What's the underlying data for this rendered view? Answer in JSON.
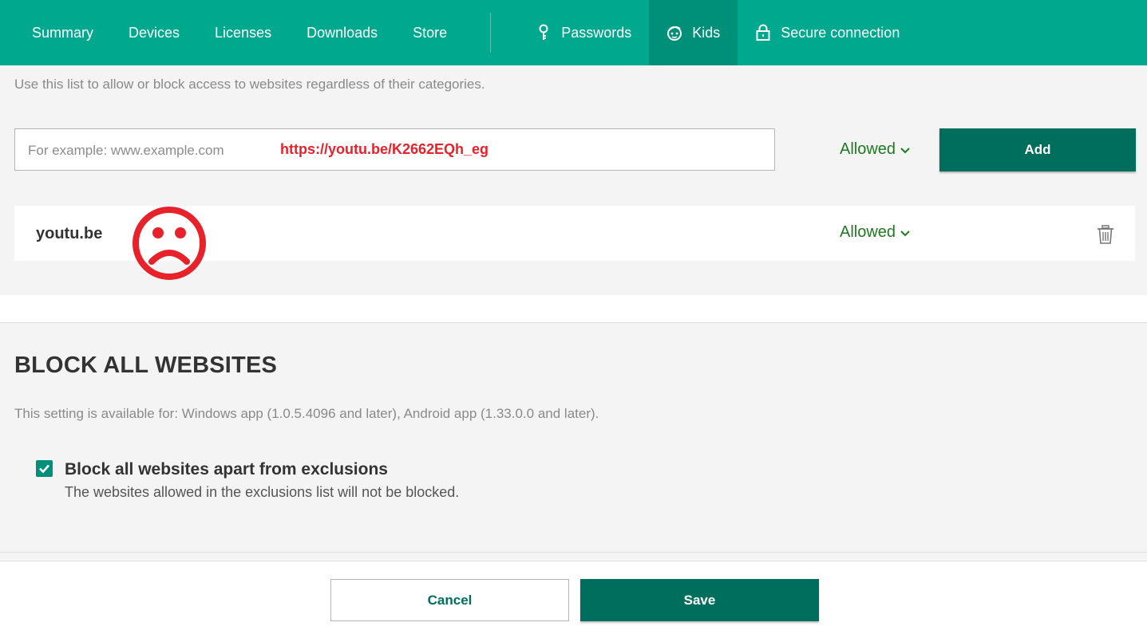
{
  "nav": {
    "items": [
      {
        "label": "Summary"
      },
      {
        "label": "Devices"
      },
      {
        "label": "Licenses"
      },
      {
        "label": "Downloads"
      },
      {
        "label": "Store"
      }
    ],
    "secondary": [
      {
        "label": "Passwords",
        "icon": "key-icon"
      },
      {
        "label": "Kids",
        "icon": "kid-face-icon",
        "active": true
      },
      {
        "label": "Secure connection",
        "icon": "lock-icon"
      }
    ],
    "color": "#00a88e",
    "active_color": "#00907a"
  },
  "exclusions": {
    "description": "Use this list to allow or block access to websites regardless of their categories.",
    "input_placeholder": "For example: www.example.com",
    "input_value": "",
    "overlay_url": "https://youtu.be/K2662EQh_eg",
    "mode_select": "Allowed",
    "add_label": "Add",
    "entries": [
      {
        "domain": "youtu.be",
        "mode": "Allowed"
      }
    ]
  },
  "block_all": {
    "heading": "BLOCK ALL WEBSITES",
    "availability": "This setting is available for: Windows app (1.0.5.4096 and later), Android app (1.33.0.0 and later).",
    "checkbox_label": "Block all websites apart from exclusions",
    "checkbox_checked": true,
    "checkbox_description": "The websites allowed in the exclusions list will not be blocked."
  },
  "footer": {
    "cancel_label": "Cancel",
    "save_label": "Save"
  },
  "colors": {
    "primary_button": "#006e5d",
    "allowed_text": "#1e7a1e",
    "annotation_red": "#e8222a"
  }
}
